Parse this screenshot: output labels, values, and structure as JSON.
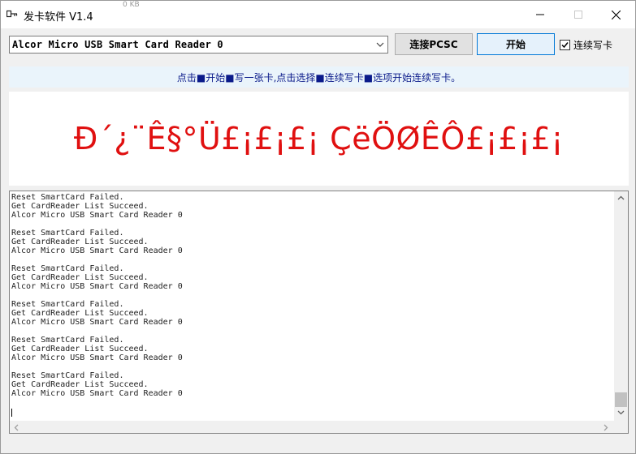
{
  "window": {
    "title": "发卡软件 V1.4",
    "ghost_text": "0 KB"
  },
  "toolbar": {
    "reader_select_value": "Alcor Micro USB Smart Card Reader 0",
    "connect_label": "连接PCSC",
    "start_label": "开始",
    "continuous_label": "连续写卡",
    "continuous_checked": true
  },
  "info": {
    "text": "点击■开始■写一张卡,点击选择■连续写卡■选项开始连续写卡。"
  },
  "banner": {
    "text": "Ð´¿¨Ê§°Ü£¡£¡£¡ ÇëÖØÊÔ£¡£¡£¡",
    "color": "#e01010"
  },
  "log": {
    "lines": [
      "Reset SmartCard Failed.",
      "Get CardReader List Succeed.",
      "Alcor Micro USB Smart Card Reader 0",
      "",
      "Reset SmartCard Failed.",
      "Get CardReader List Succeed.",
      "Alcor Micro USB Smart Card Reader 0",
      "",
      "Reset SmartCard Failed.",
      "Get CardReader List Succeed.",
      "Alcor Micro USB Smart Card Reader 0",
      "",
      "Reset SmartCard Failed.",
      "Get CardReader List Succeed.",
      "Alcor Micro USB Smart Card Reader 0",
      "",
      "Reset SmartCard Failed.",
      "Get CardReader List Succeed.",
      "Alcor Micro USB Smart Card Reader 0",
      "",
      "Reset SmartCard Failed.",
      "Get CardReader List Succeed.",
      "Alcor Micro USB Smart Card Reader 0"
    ]
  }
}
